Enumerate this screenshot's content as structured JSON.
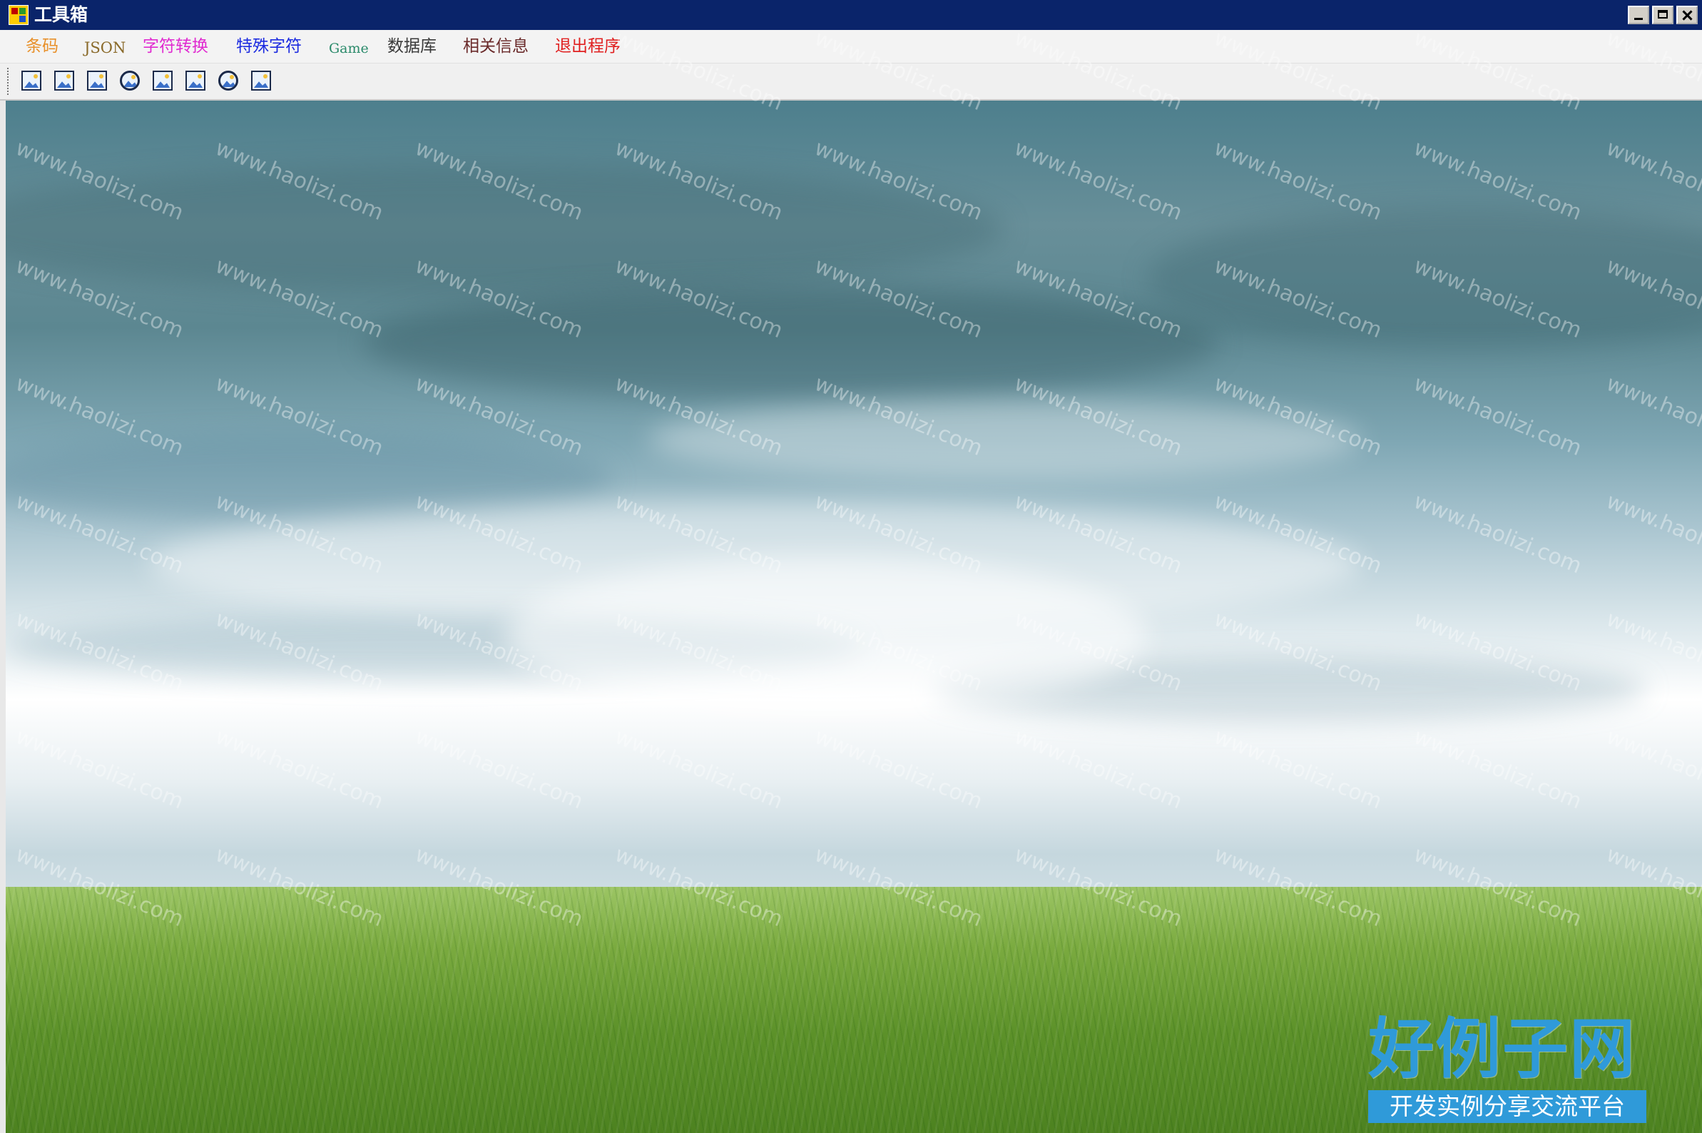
{
  "window": {
    "title": "工具箱",
    "controls": [
      "minimize-icon",
      "maximize-icon",
      "close-icon"
    ]
  },
  "menu": {
    "items": [
      {
        "label": "条码",
        "color": "#e8902a"
      },
      {
        "label": "JSON",
        "color": "#8a6a2a"
      },
      {
        "label": "字符转换",
        "color": "#e02ad0"
      },
      {
        "label": "特殊字符",
        "color": "#1b2ae0"
      },
      {
        "label": "Game",
        "color": "#2a8a6a"
      },
      {
        "label": "数据库",
        "color": "#3a3a3a"
      },
      {
        "label": "相关信息",
        "color": "#6a2a2a"
      },
      {
        "label": "退出程序",
        "color": "#e02020"
      }
    ]
  },
  "toolbar": {
    "icons": [
      "image-icon",
      "image-icon",
      "image-icon",
      "image-round-icon",
      "image-icon",
      "image-icon",
      "image-round-icon",
      "image-icon"
    ]
  },
  "watermark": {
    "text": "www.haolizi.com",
    "logo_title": "好例子网",
    "logo_subtitle": "开发实例分享交流平台"
  }
}
